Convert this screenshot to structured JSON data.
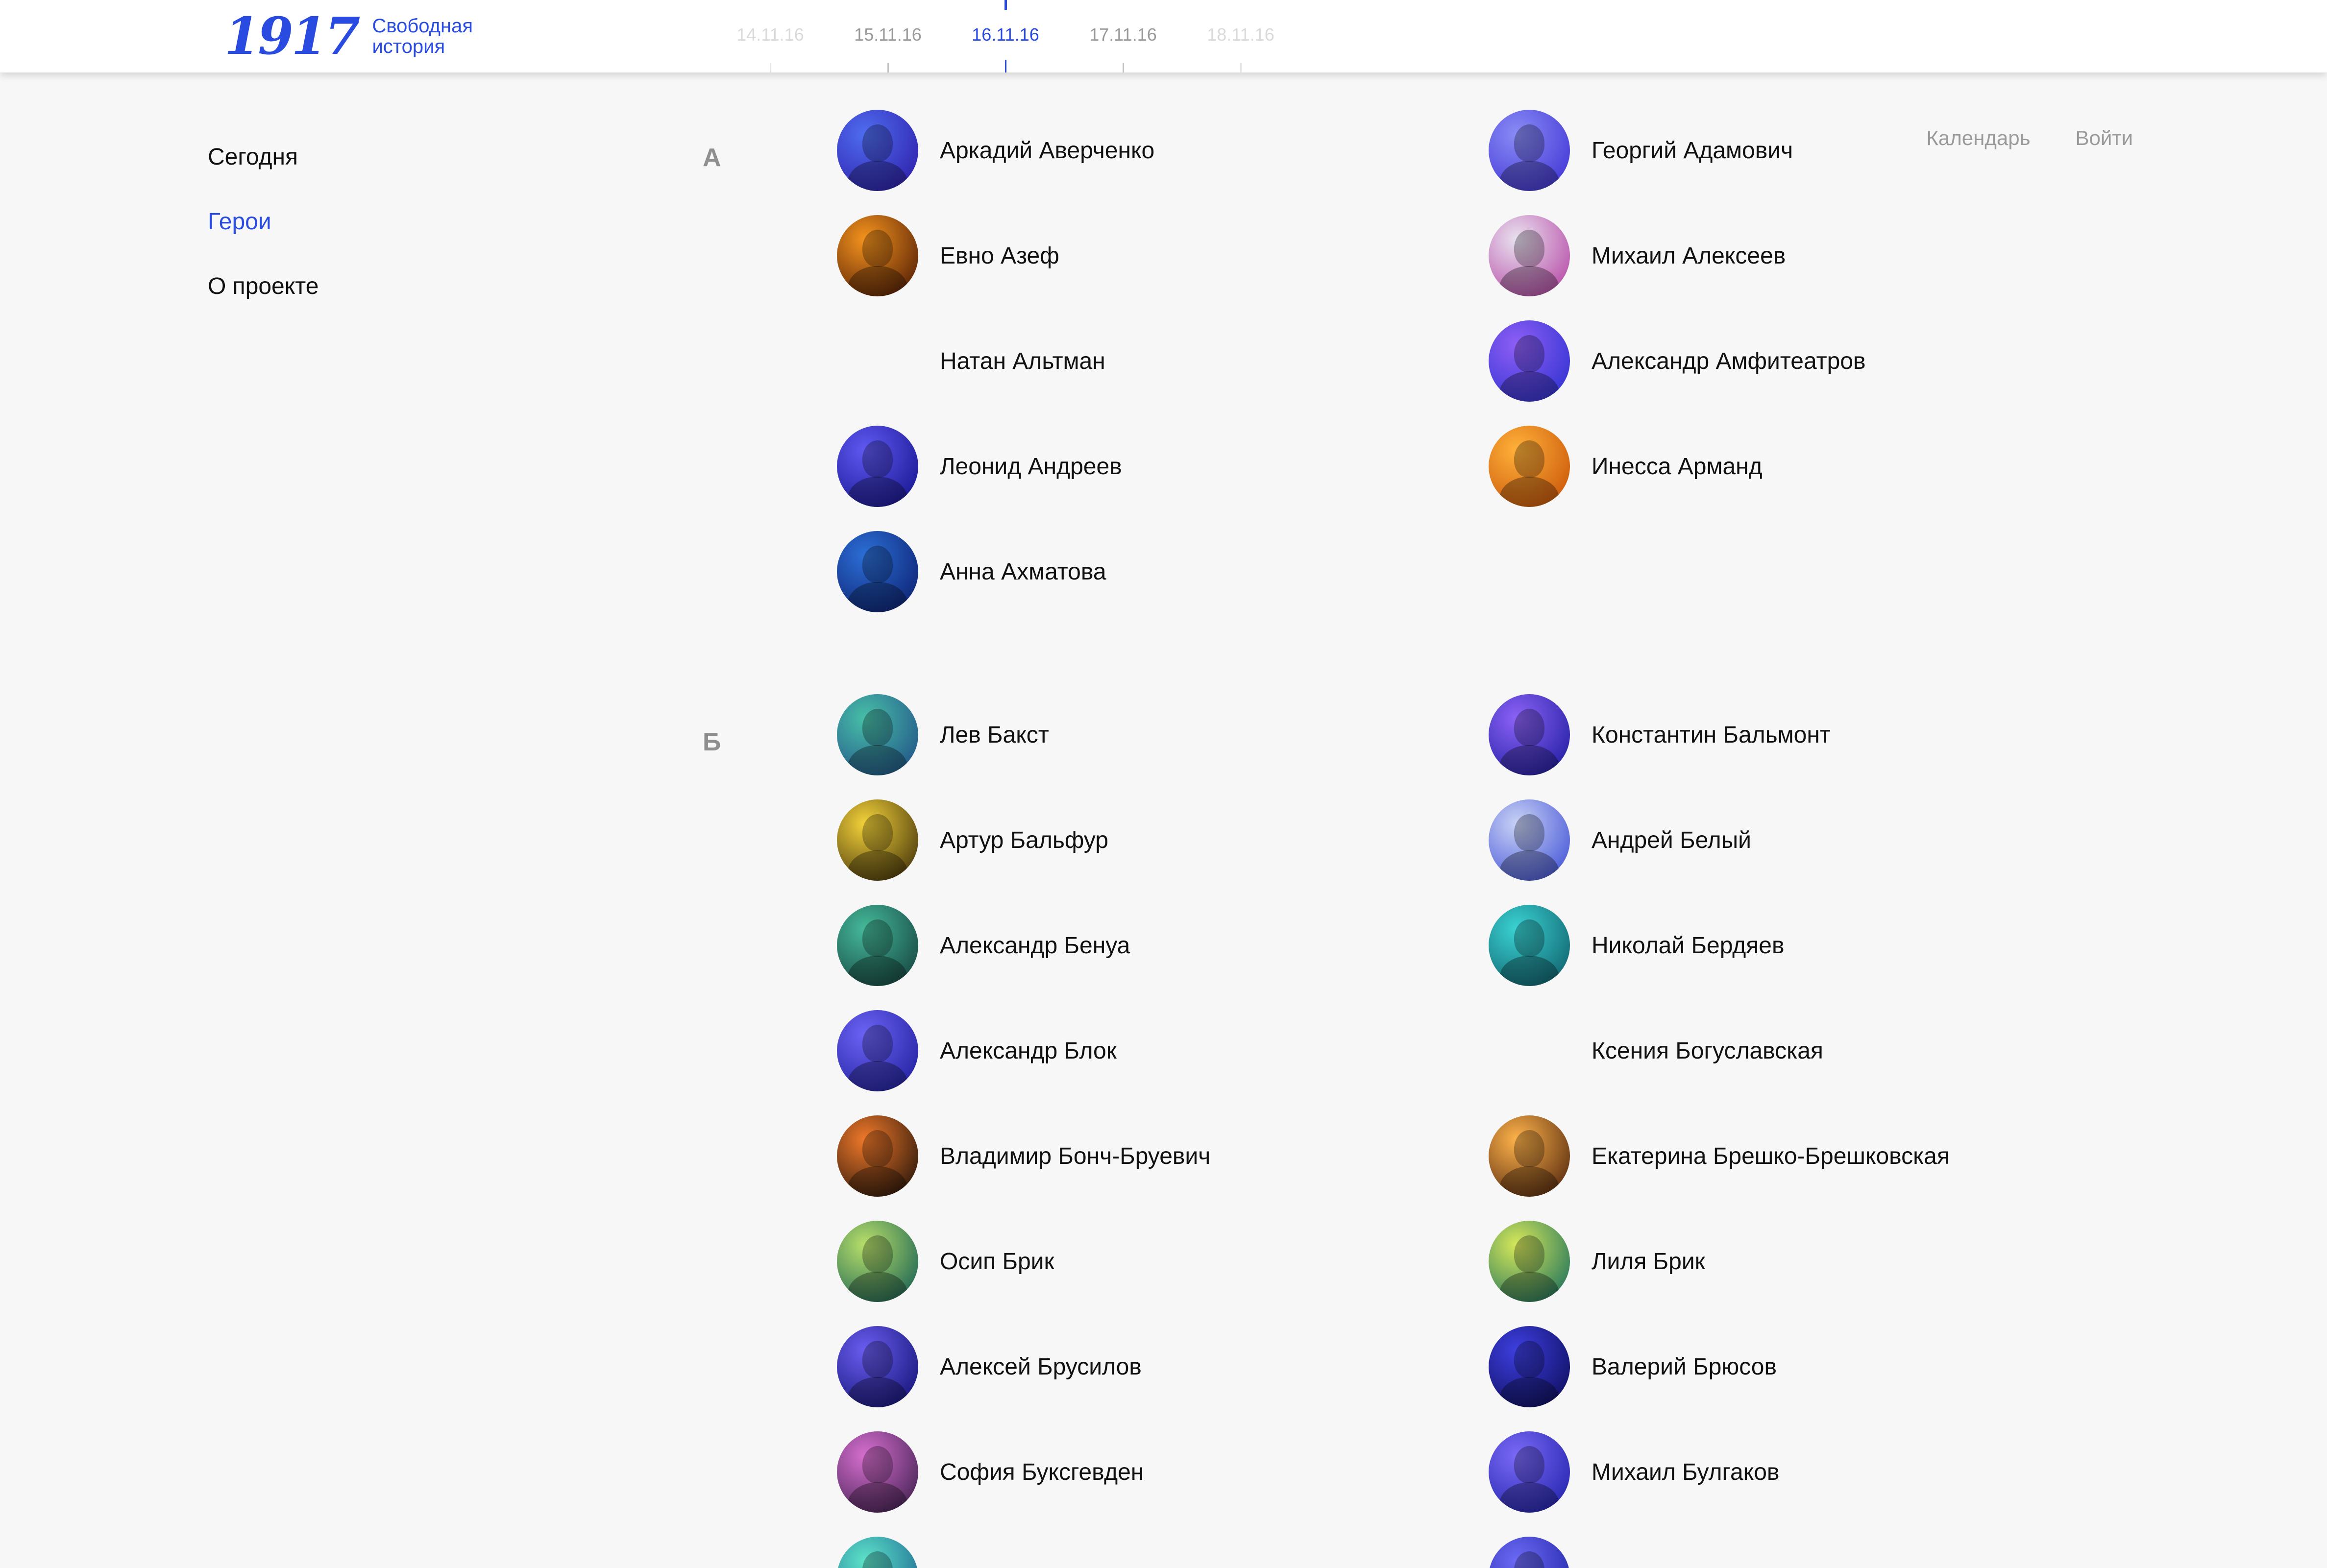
{
  "brand": {
    "logo_mark": "1917",
    "logo_line1": "Свободная",
    "logo_line2": "история",
    "accent": "#2a4be0"
  },
  "timeline": {
    "dates": [
      {
        "label": "14.11.16",
        "state": "faded"
      },
      {
        "label": "15.11.16",
        "state": "normal"
      },
      {
        "label": "16.11.16",
        "state": "active"
      },
      {
        "label": "17.11.16",
        "state": "normal"
      },
      {
        "label": "18.11.16",
        "state": "faded"
      }
    ]
  },
  "nav": {
    "items": [
      {
        "label": "Сегодня",
        "active": false
      },
      {
        "label": "Герои",
        "active": true
      },
      {
        "label": "О проекте",
        "active": false
      }
    ]
  },
  "toplinks": {
    "calendar": "Календарь",
    "login": "Войти"
  },
  "sections": [
    {
      "letter": "А",
      "heroes": [
        {
          "name": "Аркадий Аверченко",
          "avatar": [
            "#4f6df0",
            "#2c1aa6"
          ]
        },
        {
          "name": "Георгий Адамович",
          "avatar": [
            "#8a8cf6",
            "#3c2fd2"
          ]
        },
        {
          "name": "Евно Азеф",
          "avatar": [
            "#f5941e",
            "#4a1704"
          ]
        },
        {
          "name": "Михаил Алексеев",
          "avatar": [
            "#e9e2f0",
            "#b33fa1"
          ]
        },
        {
          "name": "Натан Альтман",
          "avatar": null
        },
        {
          "name": "Александр Амфитеатров",
          "avatar": [
            "#8e5ff5",
            "#2a2fcf"
          ]
        },
        {
          "name": "Леонид Андреев",
          "avatar": [
            "#5f59f2",
            "#14128a"
          ]
        },
        {
          "name": "Инесса Арманд",
          "avatar": [
            "#ffb23a",
            "#c74f06"
          ]
        },
        {
          "name": "Анна Ахматова",
          "avatar": [
            "#2c6fd6",
            "#0b1d6b"
          ]
        }
      ]
    },
    {
      "letter": "Б",
      "heroes": [
        {
          "name": "Лев Бакст",
          "avatar": [
            "#48bfa8",
            "#1f4c86"
          ]
        },
        {
          "name": "Константин Бальмонт",
          "avatar": [
            "#8c62f7",
            "#1a1a9c"
          ]
        },
        {
          "name": "Артур Бальфур",
          "avatar": [
            "#f4d33a",
            "#3a2a08"
          ]
        },
        {
          "name": "Андрей Белый",
          "avatar": [
            "#c9d2f6",
            "#3b4dd4"
          ]
        },
        {
          "name": "Александр Бенуа",
          "avatar": [
            "#45b99a",
            "#133e3a"
          ]
        },
        {
          "name": "Николай Бердяев",
          "avatar": [
            "#3ad3d3",
            "#0d5a66"
          ]
        },
        {
          "name": "Александр Блок",
          "avatar": [
            "#6c63f5",
            "#1d1d9a"
          ]
        },
        {
          "name": "Ксения Богуславская",
          "avatar": null
        },
        {
          "name": "Владимир Бонч-Бруевич",
          "avatar": [
            "#f0792a",
            "#1a0f08"
          ]
        },
        {
          "name": "Екатерина Брешко-Брешковская",
          "avatar": [
            "#ffb34a",
            "#4a1f0a"
          ]
        },
        {
          "name": "Осип Брик",
          "avatar": [
            "#b9e06a",
            "#0f5a52"
          ]
        },
        {
          "name": "Лиля Брик",
          "avatar": [
            "#d7e85a",
            "#126a5c"
          ]
        },
        {
          "name": "Алексей Брусилов",
          "avatar": [
            "#6a5df0",
            "#101070"
          ]
        },
        {
          "name": "Валерий Брюсов",
          "avatar": [
            "#3d3fe0",
            "#0b0b55"
          ]
        },
        {
          "name": "София Буксгевден",
          "avatar": [
            "#d76fd0",
            "#3a1d4a"
          ]
        },
        {
          "name": "Михаил Булгаков",
          "avatar": [
            "#7a6af7",
            "#1e1fa8"
          ]
        },
        {
          "name": "",
          "avatar": [
            "#5de3c9",
            "#175c8c"
          ]
        },
        {
          "name": "",
          "avatar": [
            "#6c6af5",
            "#1a1fa0"
          ]
        }
      ]
    }
  ]
}
